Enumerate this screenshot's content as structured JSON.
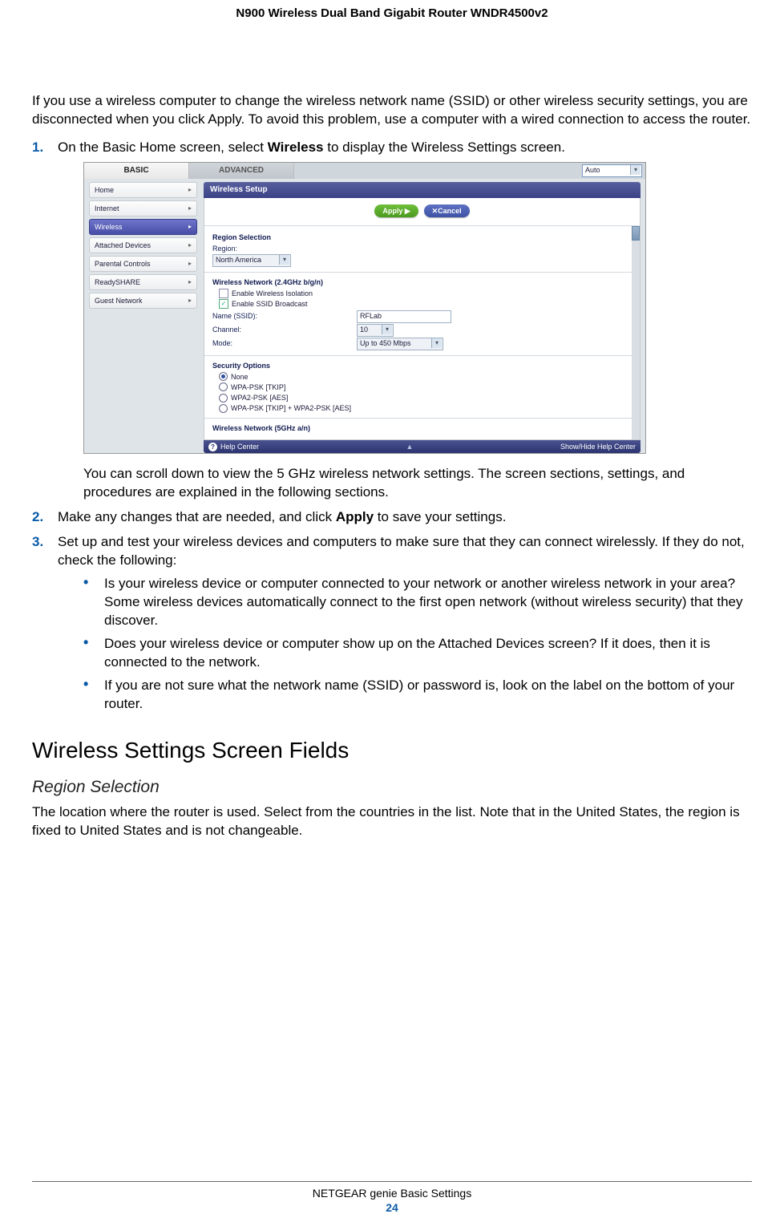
{
  "header": {
    "title": "N900 Wireless Dual Band Gigabit Router WNDR4500v2"
  },
  "intro": "If you use a wireless computer to change the wireless network name (SSID) or other wireless security settings, you are disconnected when you click Apply. To avoid this problem, use a computer with a wired connection to access the router.",
  "step1": {
    "pre": "On the Basic Home screen, select ",
    "bold": "Wireless",
    "post": " to display the Wireless Settings screen."
  },
  "screenshot": {
    "tab_basic": "BASIC",
    "tab_advanced": "ADVANCED",
    "auto": "Auto",
    "sidebar": [
      "Home",
      "Internet",
      "Wireless",
      "Attached Devices",
      "Parental Controls",
      "ReadySHARE",
      "Guest Network"
    ],
    "panel_title": "Wireless Setup",
    "btn_apply": "Apply ▶",
    "btn_cancel": "✕Cancel",
    "sec_region_title": "Region Selection",
    "region_label": "Region:",
    "region_value": "North America",
    "sec_24_title": "Wireless Network (2.4GHz b/g/n)",
    "chk_iso": "Enable Wireless Isolation",
    "chk_bcast": "Enable SSID Broadcast",
    "name_label": "Name (SSID):",
    "name_value": "RFLab",
    "channel_label": "Channel:",
    "channel_value": "10",
    "mode_label": "Mode:",
    "mode_value": "Up to 450 Mbps",
    "sec_security_title": "Security Options",
    "radio_none": "None",
    "radio_tkip": "WPA-PSK [TKIP]",
    "radio_aes": "WPA2-PSK [AES]",
    "radio_both": "WPA-PSK [TKIP] + WPA2-PSK [AES]",
    "sec_5_title": "Wireless Network (5GHz a/n)",
    "help_label": "Help Center",
    "help_toggle": "Show/Hide Help Center"
  },
  "after_screenshot": "You can scroll down to view the 5 GHz wireless network settings. The screen sections, settings, and procedures are explained in the following sections.",
  "step2": {
    "pre": "Make any changes that are needed, and click ",
    "bold": "Apply",
    "post": " to save your settings."
  },
  "step3": "Set up and test your wireless devices and computers to make sure that they can connect wirelessly. If they do not, check the following:",
  "bullets": [
    "Is your wireless device or computer connected to your network or another wireless network in your area? Some wireless devices automatically connect to the first open network (without wireless security) that they discover.",
    "Does your wireless device or computer show up on the Attached Devices screen? If it does, then it is connected to the network.",
    "If you are not sure what the network name (SSID) or password is, look on the label on the bottom of your router."
  ],
  "h2": "Wireless Settings Screen Fields",
  "h3": "Region Selection",
  "region_para": "The location where the router is used. Select from the countries in the list. Note that in the United States, the region is fixed to United States and is not changeable.",
  "footer": {
    "title": "NETGEAR genie Basic Settings",
    "page": "24"
  }
}
